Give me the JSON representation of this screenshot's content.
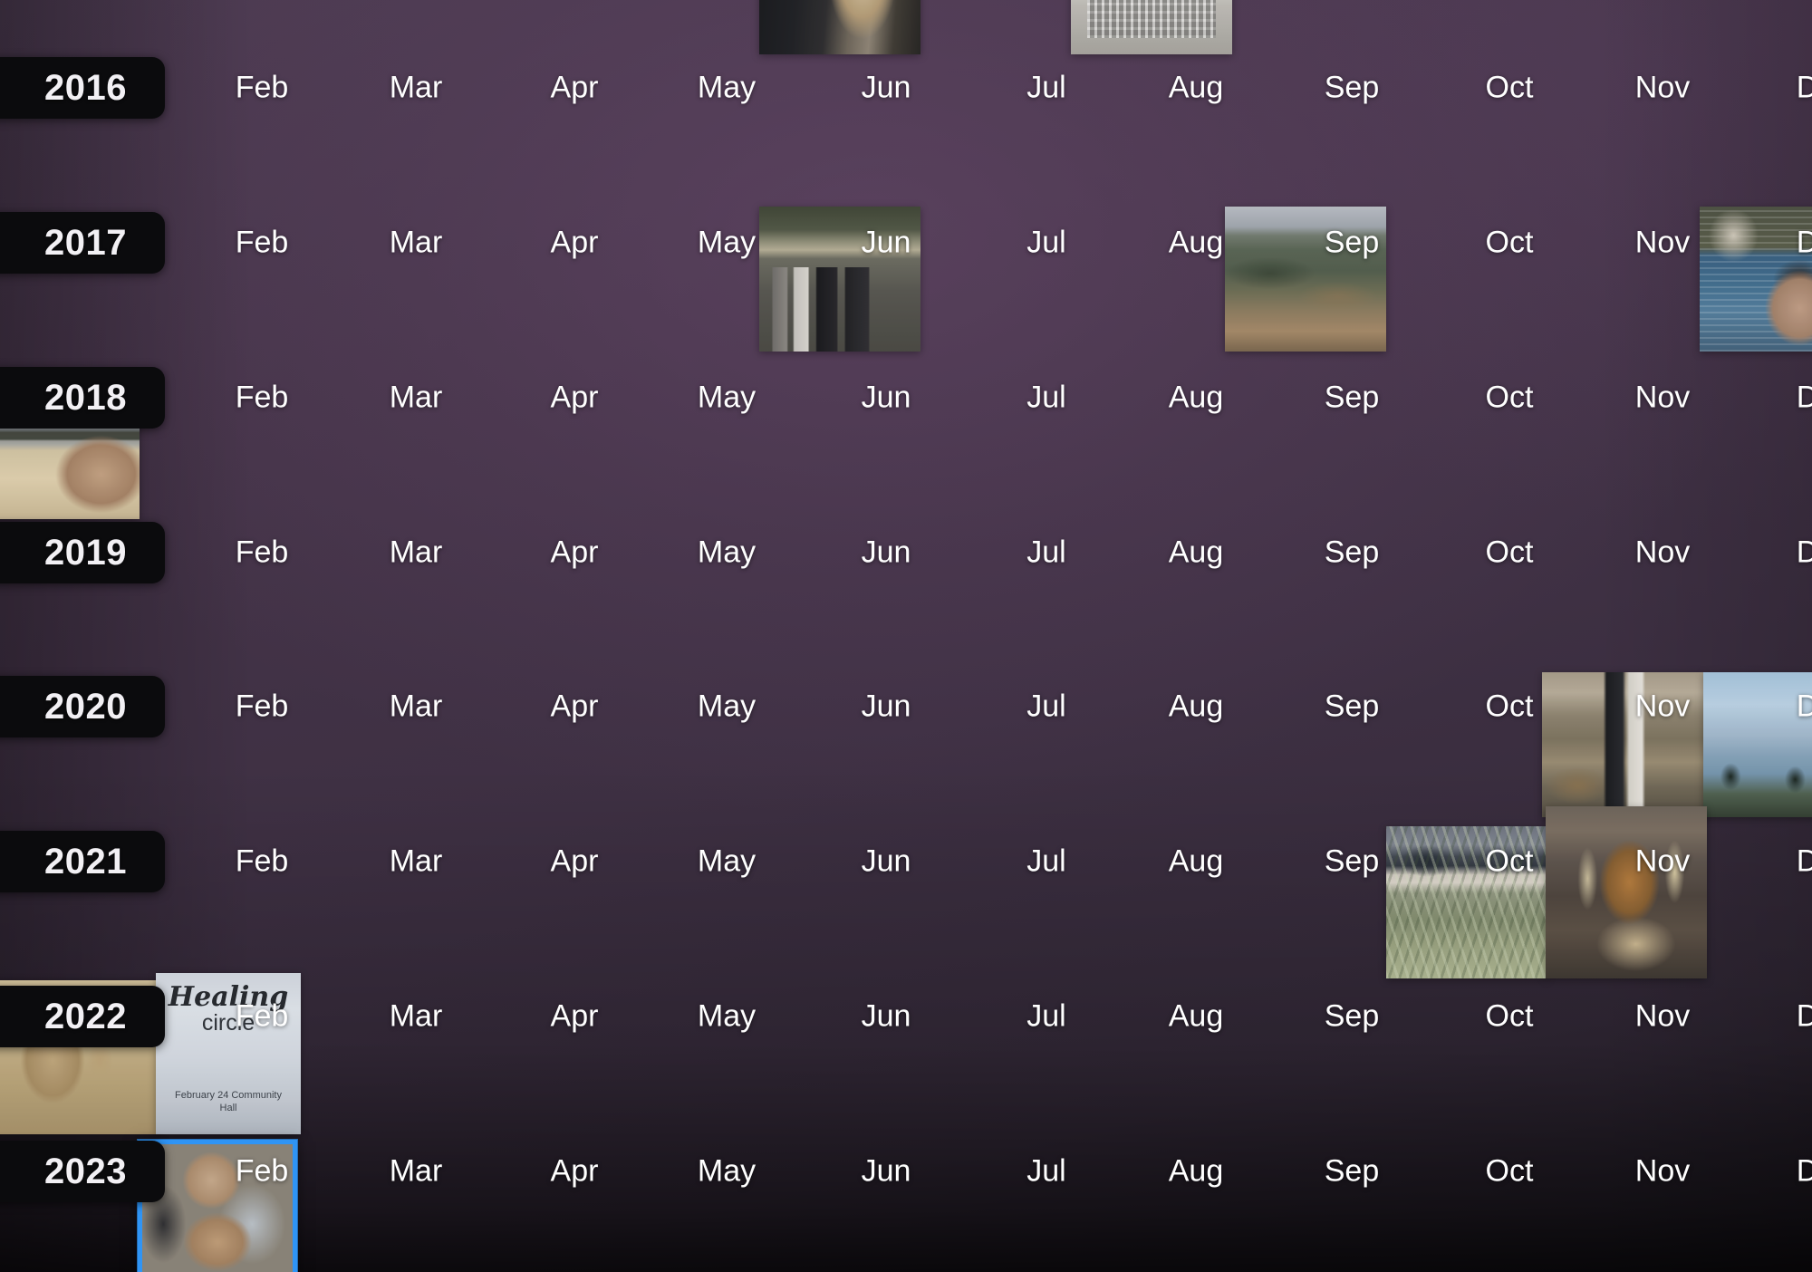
{
  "app": {
    "view": "photo-library-timeline",
    "background_color": "#3b2d41",
    "selection_color": "#2f94f5",
    "year_pill_color": "#0b0b0d",
    "month_label_color": "#ffffff"
  },
  "months": [
    "Feb",
    "Mar",
    "Apr",
    "May",
    "Jun",
    "Jul",
    "Aug",
    "Sep",
    "Oct",
    "Nov",
    "D"
  ],
  "rows": [
    {
      "year": "2016",
      "months": [
        "Feb",
        "Mar",
        "Apr",
        "May",
        "Jun",
        "Jul",
        "Aug",
        "Sep",
        "Oct",
        "Nov",
        "D"
      ]
    },
    {
      "year": "2017",
      "months": [
        "Feb",
        "Mar",
        "Apr",
        "May",
        "Jun",
        "Jul",
        "Aug",
        "Sep",
        "Oct",
        "Nov",
        "D"
      ]
    },
    {
      "year": "2018",
      "months": [
        "Feb",
        "Mar",
        "Apr",
        "May",
        "Jun",
        "Jul",
        "Aug",
        "Sep",
        "Oct",
        "Nov",
        "D"
      ]
    },
    {
      "year": "2019",
      "months": [
        "Feb",
        "Mar",
        "Apr",
        "May",
        "Jun",
        "Jul",
        "Aug",
        "Sep",
        "Oct",
        "Nov",
        "D"
      ]
    },
    {
      "year": "2020",
      "months": [
        "Feb",
        "Mar",
        "Apr",
        "May",
        "Jun",
        "Jul",
        "Aug",
        "Sep",
        "Oct",
        "Nov",
        "D"
      ]
    },
    {
      "year": "2021",
      "months": [
        "Feb",
        "Mar",
        "Apr",
        "May",
        "Jun",
        "Jul",
        "Aug",
        "Sep",
        "Oct",
        "Nov",
        "D"
      ]
    },
    {
      "year": "2022",
      "months": [
        "Feb",
        "Mar",
        "Apr",
        "May",
        "Jun",
        "Jul",
        "Aug",
        "Sep",
        "Oct",
        "Nov",
        "D"
      ]
    },
    {
      "year": "2023",
      "months": [
        "Feb",
        "Mar",
        "Apr",
        "May",
        "Jun",
        "Jul",
        "Aug",
        "Sep",
        "Oct",
        "Nov",
        "D"
      ]
    }
  ],
  "photos": [
    {
      "id": "p01",
      "name": "people-in-dark-suits",
      "row_year": "2016",
      "near_month": "Jun",
      "selected": false
    },
    {
      "id": "p02",
      "name": "white-building-courtyard",
      "row_year": "2016",
      "near_month": "Aug",
      "selected": false
    },
    {
      "id": "p03",
      "name": "group-of-friends-outdoors",
      "row_year": "2017",
      "near_month": "Jun",
      "selected": false
    },
    {
      "id": "p04",
      "name": "mountain-valley-landscape",
      "row_year": "2017",
      "near_month": "Sep",
      "selected": false
    },
    {
      "id": "p05",
      "name": "portrait-by-the-water",
      "row_year": "2017",
      "near_month": "D",
      "selected": false
    },
    {
      "id": "p06",
      "name": "person-on-the-beach",
      "row_year": "2018",
      "near_month": "Feb",
      "selected": false
    },
    {
      "id": "p07",
      "name": "workshop-interior-people",
      "row_year": "2020",
      "near_month": "Nov",
      "selected": false
    },
    {
      "id": "p08",
      "name": "ocean-view-palm-trees",
      "row_year": "2020",
      "near_month": "D",
      "selected": false
    },
    {
      "id": "p09",
      "name": "agave-field-with-volcano",
      "row_year": "2021",
      "near_month": "Oct",
      "selected": false
    },
    {
      "id": "p10",
      "name": "decorated-altar-ofrenda",
      "row_year": "2021",
      "near_month": "Nov",
      "selected": false
    },
    {
      "id": "p11",
      "name": "painted-portrait-artwork",
      "row_year": "2022",
      "near_month": "Feb",
      "selected": false
    },
    {
      "id": "p12",
      "name": "healing-circle-flyer",
      "row_year": "2022",
      "near_month": "Feb",
      "selected": false
    },
    {
      "id": "p13",
      "name": "person-shaping-pottery",
      "row_year": "2023",
      "near_month": "Feb",
      "selected": true
    }
  ],
  "flyer": {
    "line1": "Healing",
    "line2": "circle",
    "sub": "February 24\nCommunity Hall"
  }
}
